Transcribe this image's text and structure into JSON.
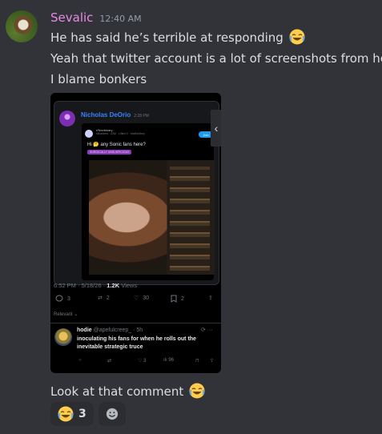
{
  "message": {
    "username": "Sevalic",
    "timestamp": "12:40 AM",
    "lines": [
      "He has said he’s terrible at responding",
      "Yeah that twitter account is a lot of screenshots from here",
      "I blame bonkers"
    ],
    "after_image": "Look at that comment"
  },
  "embed": {
    "quote_author": "Nicholas DeOrio",
    "quote_time": "2:28 PM",
    "inner_name": "r/Nonbinary",
    "inner_meta": "r/Bonkers · 22M · Lifted X · shelhe/they",
    "join_label": "Join",
    "inner_text": "Hi 🤔 any Sonic fans here?",
    "inner_tag": "SURGICALLY UNSUSPICIOUS",
    "stats_time": "6:52 PM · 5/18/26 · ",
    "stats_views": "1.2K",
    "stats_views_label": " Views",
    "actions": {
      "reply": "3",
      "retweet": "2",
      "like": "30",
      "bookmark": "2"
    },
    "relevant_label": "Relevant ⌄",
    "reply": {
      "name": "hodie",
      "handle": " @apefulcreep_ · 5h",
      "text": "inoculating his fans for when he rolls out the inevitable strategic truce",
      "likes": "3",
      "views": "96"
    }
  },
  "reactions": [
    {
      "icon": "joy-emoji",
      "count": "3"
    }
  ],
  "colors": {
    "background": "#313338",
    "username": "#e68ae6",
    "link_blue": "#3b82f6"
  }
}
